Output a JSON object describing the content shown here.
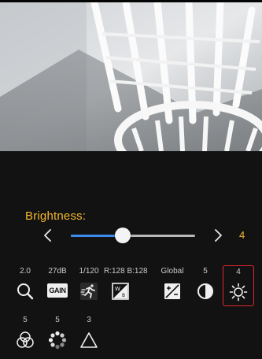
{
  "brightness": {
    "label": "Brightness:",
    "value": "4",
    "level": 0.42
  },
  "toolbar_row1": [
    {
      "name": "zoom",
      "value": "2.0",
      "icon": "magnifier-icon"
    },
    {
      "name": "gain",
      "value": "27dB",
      "icon": "gain-icon",
      "icon_text": "GAIN"
    },
    {
      "name": "shutter",
      "value": "1/120",
      "icon": "running-man-icon"
    },
    {
      "name": "white-balance",
      "value": "R:128 B:128",
      "icon": "white-balance-icon"
    },
    {
      "name": "exposure-mode",
      "value": "Global",
      "icon": "exposure-icon"
    },
    {
      "name": "contrast",
      "value": "5",
      "icon": "contrast-icon"
    },
    {
      "name": "brightness",
      "value": "4",
      "icon": "sun-icon",
      "selected": true
    }
  ],
  "toolbar_row2": [
    {
      "name": "saturation",
      "value": "5",
      "icon": "color-circles-icon"
    },
    {
      "name": "hue",
      "value": "5",
      "icon": "hue-wheel-icon"
    },
    {
      "name": "sharpness",
      "value": "3",
      "icon": "triangle-icon"
    }
  ],
  "colors": {
    "accent": "#f5b731",
    "slider_fill": "#3b8bea",
    "selection_border": "#e0282e",
    "panel_background": "#121212"
  }
}
